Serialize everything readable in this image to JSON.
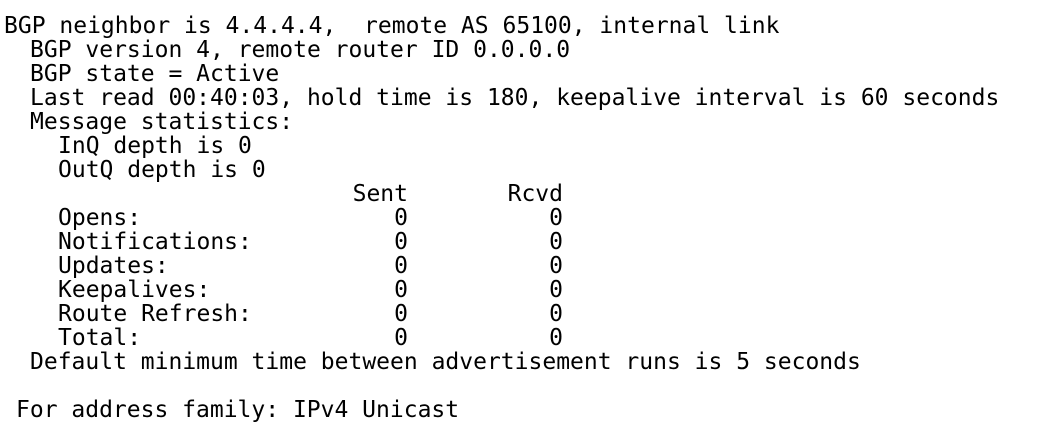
{
  "neighbor": {
    "header": "BGP neighbor is 4.4.4.4,  remote AS 65100, internal link",
    "version": "BGP version 4, remote router ID 0.0.0.0",
    "state": "BGP state = Active",
    "timers": "Last read 00:40:03, hold time is 180, keepalive interval is 60 seconds",
    "msg_stats_title": "Message statistics:",
    "inq": "InQ depth is 0",
    "outq": "OutQ depth is 0"
  },
  "stats_table": {
    "headers": {
      "sent": "Sent",
      "rcvd": "Rcvd"
    },
    "rows": [
      {
        "label": "Opens:",
        "sent": "0",
        "rcvd": "0"
      },
      {
        "label": "Notifications:",
        "sent": "0",
        "rcvd": "0"
      },
      {
        "label": "Updates:",
        "sent": "0",
        "rcvd": "0"
      },
      {
        "label": "Keepalives:",
        "sent": "0",
        "rcvd": "0"
      },
      {
        "label": "Route Refresh:",
        "sent": "0",
        "rcvd": "0"
      },
      {
        "label": "Total:",
        "sent": "0",
        "rcvd": "0"
      }
    ]
  },
  "advertisement": "Default minimum time between advertisement runs is 5 seconds",
  "address_family": "For address family: IPv4 Unicast"
}
